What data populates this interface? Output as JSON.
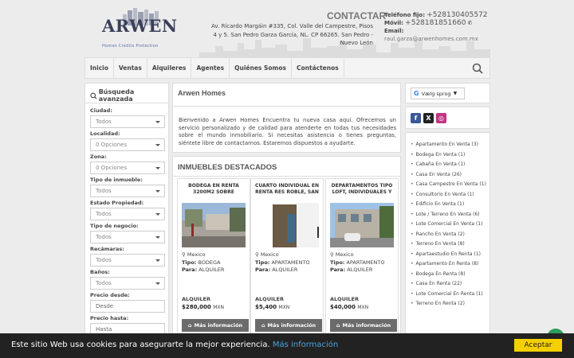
{
  "header": {
    "brand": "ARWEN",
    "tagline": "Homes     Credits     Protection",
    "contact_title": "CONTACTAR",
    "address": "Av. Ricardo Margáin #335, Col. Valle del Campestre, Pisos 4 y 5. San Pedro Garza García, NL. CP 66265. San Pedro - Nuevo León",
    "phone_label": "Teléfono fijo:",
    "phone": "+528130405572",
    "mobile_label": "Móvil:",
    "mobile": "+528181851660",
    "email_label": "Email:",
    "email": "raul.garza@arwenhomes.com.mx"
  },
  "nav": {
    "items": [
      "Inicio",
      "Ventas",
      "Alquileres",
      "Agentes",
      "Quiénes Somos",
      "Contáctenos"
    ]
  },
  "filter": {
    "title": "Búsqueda avanzada",
    "fields": [
      {
        "label": "Ciudad:",
        "value": "Todos"
      },
      {
        "label": "Localidad:",
        "value": "0 Opciones"
      },
      {
        "label": "Zona:",
        "value": "0 Opciones"
      },
      {
        "label": "Tipo de inmueble:",
        "value": "Todos"
      },
      {
        "label": "Estado Propiedad:",
        "value": "Todos"
      },
      {
        "label": "Tipo de negocio:",
        "value": "Todos"
      },
      {
        "label": "Recámaras:",
        "value": "Todos"
      },
      {
        "label": "Baños:",
        "value": "Todos"
      }
    ],
    "price_from_label": "Precio desde:",
    "price_from_placeholder": "Desde",
    "price_to_label": "Precio hasta:",
    "price_to_placeholder": "Hasta"
  },
  "about": {
    "title": "Arwen Homes",
    "text": "Bienvenido a Arwen Homes Encuentra tu nueva casa aquí. Ofrecemos un servicio personalizado y de calidad para atenderte en todas tus necesidades sobre el mundo inmobiliario. Si necesitas asistencia o tienes preguntas, siéntete libre de contactarnos. Estaremos dispuestos a ayudarte."
  },
  "featured": {
    "title": "INMUEBLES DESTACADOS",
    "tipo_label": "Tipo:",
    "para_label": "Para:",
    "button_label": "Más información",
    "currency": "MXN",
    "cards": [
      {
        "title": "BODEGA EN RENTA 3200M2 SOBRE",
        "location": "Mexico",
        "tipo": "BODEGA",
        "para": "ALQUILER",
        "op": "ALQUILER",
        "price": "$280,000"
      },
      {
        "title": "CUARTO INDIVIDUAL EN RENTA RES ROBLE, SAN",
        "location": "Mexico",
        "tipo": "APARTAMENTO",
        "para": "ALQUILER",
        "op": "ALQUILER",
        "price": "$5,400"
      },
      {
        "title": "DEPARTAMENTOS TIPO LOFT, INDIVIDUALES Y",
        "location": "Mexico",
        "tipo": "APARTAMENTO",
        "para": "ALQUILER",
        "op": "ALQUILER",
        "price": "$40,000"
      }
    ]
  },
  "translate": {
    "label": "Vælg sprog"
  },
  "social": {
    "facebook": "f",
    "x": "X",
    "instagram": "◎"
  },
  "categories": [
    "Apartamento En Venta (3)",
    "Bodega En Venta (1)",
    "Cabaña En Venta (1)",
    "Casa En Venta (26)",
    "Casa Campestre En Venta (1)",
    "Consultorio En Venta (1)",
    "Edificio En Venta (1)",
    "Lote / Terreno En Venta (6)",
    "Lote Comercial En Venta (1)",
    "Rancho En Venta (2)",
    "Terreno En Venta (8)",
    "Apartaestudio En Renta (1)",
    "Apartamento En Renta (8)",
    "Bodega En Renta (8)",
    "Casa En Renta (22)",
    "Lote Comercial En Renta (1)",
    "Terreno En Renta (2)"
  ],
  "cookie": {
    "message": "Este sitio Web usa cookies para asegurarte la mejor experiencia.",
    "link": "Más información",
    "accept": "Aceptar"
  },
  "colors": {
    "accent_dark": "#3a3f59",
    "button_gray": "#6b6b6b",
    "cookie_bg": "#222222",
    "accept_yellow": "#f5d000",
    "link_blue": "#4aa3df"
  }
}
